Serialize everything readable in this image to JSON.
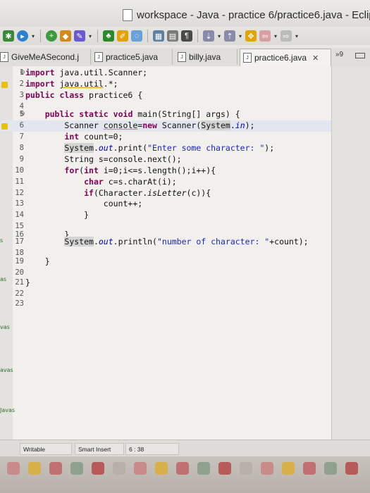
{
  "window": {
    "title": "workspace - Java - practice 6/practice6.java - Eclipse"
  },
  "toolbar": {
    "icons": [
      "debug-icon",
      "run-icon",
      "new-icon",
      "open-icon",
      "task-icon",
      "build-icon",
      "skip-icon",
      "bookmark-icon",
      "pin-icon",
      "pilcrow-icon",
      "next-annotation-icon",
      "prev-annotation-icon",
      "back-icon",
      "forward-icon"
    ]
  },
  "tabs": [
    {
      "label": "GiveMeASecond.j",
      "active": false
    },
    {
      "label": "practice5.java",
      "active": false
    },
    {
      "label": "billy.java",
      "active": false
    },
    {
      "label": "practice6.java",
      "active": true,
      "close": "✕"
    }
  ],
  "tabs_overflow": "»9",
  "editor": {
    "lines": [
      {
        "n": "1",
        "marker": "⊖"
      },
      {
        "n": "2",
        "marker": ""
      },
      {
        "n": "3",
        "marker": ""
      },
      {
        "n": "4",
        "marker": ""
      },
      {
        "n": "5",
        "marker": "⊖"
      },
      {
        "n": "6",
        "marker": ""
      },
      {
        "n": "7",
        "marker": ""
      },
      {
        "n": "8",
        "marker": ""
      },
      {
        "n": "9",
        "marker": ""
      },
      {
        "n": "10",
        "marker": ""
      },
      {
        "n": "11",
        "marker": ""
      },
      {
        "n": "12",
        "marker": ""
      },
      {
        "n": "13",
        "marker": ""
      },
      {
        "n": "14",
        "marker": ""
      },
      {
        "n": "15",
        "marker": ""
      },
      {
        "n": "16",
        "marker": ""
      },
      {
        "n": "17",
        "marker": ""
      },
      {
        "n": "18",
        "marker": ""
      },
      {
        "n": "19",
        "marker": ""
      },
      {
        "n": "20",
        "marker": ""
      },
      {
        "n": "21",
        "marker": ""
      },
      {
        "n": "22",
        "marker": ""
      },
      {
        "n": "23",
        "marker": ""
      }
    ]
  },
  "side_labels": [
    "s",
    "as",
    "vas",
    "avas",
    "Javas"
  ],
  "status": {
    "writable": "Writable",
    "insert_mode": "Smart Insert",
    "position": "6 : 38"
  },
  "colors": {
    "keyword": "#7f0055",
    "string": "#1a25c9",
    "field": "#0000c0",
    "current_line": "#e3e6ee"
  }
}
